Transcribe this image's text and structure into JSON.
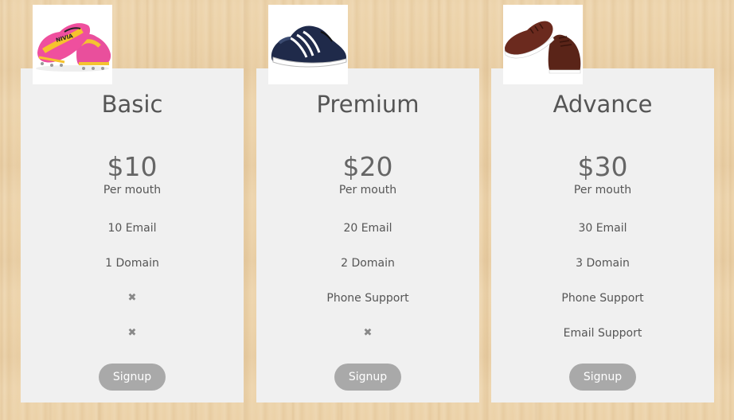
{
  "plans": [
    {
      "title": "Basic",
      "price": "$10",
      "period": "Per mouth",
      "features": [
        "10 Email",
        "1 Domain",
        "✖",
        "✖"
      ],
      "signup": "Signup",
      "image": "cleats-shoe-image"
    },
    {
      "title": "Premium",
      "price": "$20",
      "period": "Per mouth",
      "features": [
        "20 Email",
        "2 Domain",
        "Phone Support",
        "✖"
      ],
      "signup": "Signup",
      "image": "running-shoe-image"
    },
    {
      "title": "Advance",
      "price": "$30",
      "period": "Per mouth",
      "features": [
        "30 Email",
        "3 Domain",
        "Phone Support",
        "Email Support"
      ],
      "signup": "Signup",
      "image": "brown-sneaker-image"
    }
  ],
  "colors": {
    "card_bg": "#f0f0f0",
    "button_bg": "#a9a9a9",
    "text": "#555555",
    "background_wood": "#ecd2a8"
  }
}
